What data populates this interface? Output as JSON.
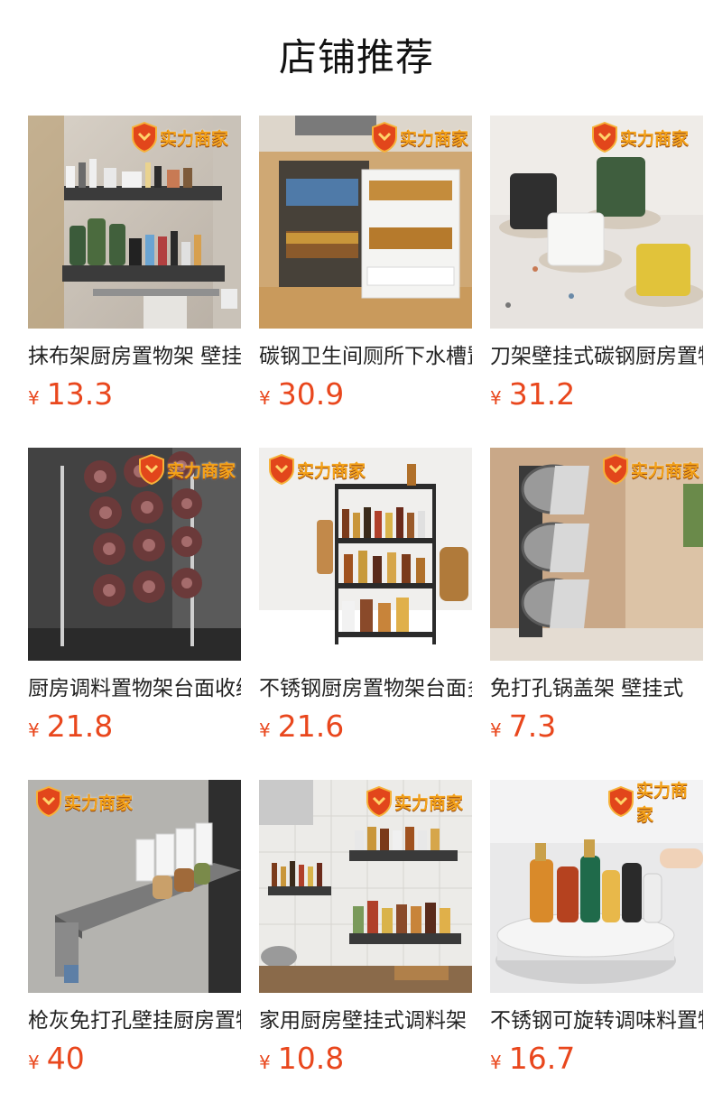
{
  "section_title": "店铺推荐",
  "badge_label": "实力商家",
  "currency_symbol": "¥",
  "colors": {
    "price": "#e9471d",
    "title": "#222222",
    "badge_text": "#f4a21a",
    "badge_shield": "#e2461b"
  },
  "products": [
    {
      "title": "抹布架厨房置物架 壁挂式",
      "price": "13.3",
      "image_icon": "wall-shelf-image"
    },
    {
      "title": "碳钢卫生间厕所下水槽置物架",
      "price": "30.9",
      "image_icon": "under-sink-rack-image"
    },
    {
      "title": "刀架壁挂式碳钢厨房置物架",
      "price": "31.2",
      "image_icon": "knife-holder-image"
    },
    {
      "title": "厨房调料置物架台面收纳",
      "price": "21.8",
      "image_icon": "lid-rack-image"
    },
    {
      "title": "不锈钢厨房置物架台面多层",
      "price": "21.6",
      "image_icon": "spice-rack-image"
    },
    {
      "title": "免打孔锅盖架 壁挂式",
      "price": "7.3",
      "image_icon": "pot-lid-holder-image"
    },
    {
      "title": "枪灰免打孔壁挂厨房置物架",
      "price": "40",
      "image_icon": "floating-shelf-image"
    },
    {
      "title": "家用厨房壁挂式调料架",
      "price": "10.8",
      "image_icon": "hanging-spice-shelf-image"
    },
    {
      "title": "不锈钢可旋转调味料置物架",
      "price": "16.7",
      "image_icon": "rotating-tray-image"
    }
  ]
}
